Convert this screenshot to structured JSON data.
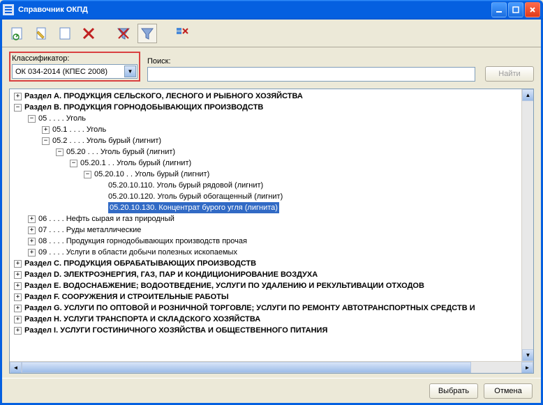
{
  "title": "Справочник ОКПД",
  "toolbar": {
    "icons": [
      "refresh-icon",
      "edit-icon",
      "new-icon",
      "delete-icon",
      "filter-funnel-icon",
      "filter-icon",
      "filter-column-icon"
    ]
  },
  "filter": {
    "classifier_label": "Классификатор:",
    "classifier_value": "ОК 034-2014 (КПЕС 2008)",
    "search_label": "Поиск:",
    "search_value": "",
    "find_button": "Найти"
  },
  "tree": [
    {
      "indent": 0,
      "exp": "+",
      "bold": true,
      "text": "Раздел A. ПРОДУКЦИЯ СЕЛЬСКОГО, ЛЕСНОГО И РЫБНОГО ХОЗЯЙСТВА"
    },
    {
      "indent": 0,
      "exp": "-",
      "bold": true,
      "text": "Раздел B. ПРОДУКЦИЯ ГОРНОДОБЫВАЮЩИХ ПРОИЗВОДСТВ"
    },
    {
      "indent": 1,
      "exp": "-",
      "bold": false,
      "text": "05 .  .  .  . Уголь"
    },
    {
      "indent": 2,
      "exp": "+",
      "bold": false,
      "text": "05.1 .  .  .  . Уголь"
    },
    {
      "indent": 2,
      "exp": "-",
      "bold": false,
      "text": "05.2 .  .  .  . Уголь бурый (лигнит)"
    },
    {
      "indent": 3,
      "exp": "-",
      "bold": false,
      "text": "05.20 .  .  . Уголь бурый (лигнит)"
    },
    {
      "indent": 4,
      "exp": "-",
      "bold": false,
      "text": "05.20.1 .  . Уголь бурый (лигнит)"
    },
    {
      "indent": 5,
      "exp": "-",
      "bold": false,
      "text": "05.20.10 .  . Уголь бурый (лигнит)"
    },
    {
      "indent": 6,
      "exp": "",
      "bold": false,
      "text": "05.20.10.110. Уголь бурый рядовой (лигнит)"
    },
    {
      "indent": 6,
      "exp": "",
      "bold": false,
      "text": "05.20.10.120. Уголь бурый обогащенный (лигнит)"
    },
    {
      "indent": 6,
      "exp": "",
      "bold": false,
      "text": "05.20.10.130. Концентрат бурого угля (лигнита)",
      "selected": true
    },
    {
      "indent": 1,
      "exp": "+",
      "bold": false,
      "text": "06 .  .  .  . Нефть сырая и газ природный"
    },
    {
      "indent": 1,
      "exp": "+",
      "bold": false,
      "text": "07 .  .  .  . Руды металлические"
    },
    {
      "indent": 1,
      "exp": "+",
      "bold": false,
      "text": "08 .  .  .  . Продукция горнодобывающих производств прочая"
    },
    {
      "indent": 1,
      "exp": "+",
      "bold": false,
      "text": "09 .  .  .  . Услуги в области добычи полезных ископаемых"
    },
    {
      "indent": 0,
      "exp": "+",
      "bold": true,
      "text": "Раздел C. ПРОДУКЦИЯ ОБРАБАТЫВАЮЩИХ ПРОИЗВОДСТВ"
    },
    {
      "indent": 0,
      "exp": "+",
      "bold": true,
      "text": "Раздел D. ЭЛЕКТРОЭНЕРГИЯ, ГАЗ, ПАР И КОНДИЦИОНИРОВАНИЕ ВОЗДУХА"
    },
    {
      "indent": 0,
      "exp": "+",
      "bold": true,
      "text": "Раздел E. ВОДОСНАБЖЕНИЕ; ВОДООТВЕДЕНИЕ, УСЛУГИ ПО УДАЛЕНИЮ И РЕКУЛЬТИВАЦИИ ОТХОДОВ"
    },
    {
      "indent": 0,
      "exp": "+",
      "bold": true,
      "text": "Раздел F. СООРУЖЕНИЯ И СТРОИТЕЛЬНЫЕ РАБОТЫ"
    },
    {
      "indent": 0,
      "exp": "+",
      "bold": true,
      "text": "Раздел G. УСЛУГИ ПО ОПТОВОЙ И РОЗНИЧНОЙ ТОРГОВЛЕ; УСЛУГИ ПО РЕМОНТУ АВТОТРАНСПОРТНЫХ СРЕДСТВ И"
    },
    {
      "indent": 0,
      "exp": "+",
      "bold": true,
      "text": "Раздел H. УСЛУГИ ТРАНСПОРТА И СКЛАДСКОГО ХОЗЯЙСТВА"
    },
    {
      "indent": 0,
      "exp": "+",
      "bold": true,
      "text": "Раздел I. УСЛУГИ ГОСТИНИЧНОГО ХОЗЯЙСТВА И ОБЩЕСТВЕННОГО ПИТАНИЯ"
    }
  ],
  "footer": {
    "select": "Выбрать",
    "cancel": "Отмена"
  }
}
